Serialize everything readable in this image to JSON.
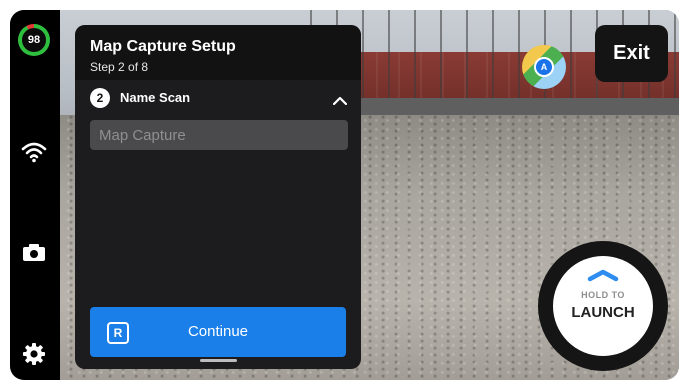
{
  "status": {
    "battery_percent": "98"
  },
  "setup_panel": {
    "title": "Map Capture Setup",
    "subtitle": "Step 2 of 8",
    "step": {
      "number": "2",
      "label": "Name Scan"
    },
    "name_input": {
      "placeholder": "Map Capture",
      "value": ""
    },
    "continue_button": {
      "label": "Continue",
      "badge": "R"
    }
  },
  "header": {
    "exit_label": "Exit"
  },
  "launch": {
    "hold_text": "HOLD TO",
    "main_text": "LAUNCH"
  },
  "map_button": {
    "pin_letter": "A"
  },
  "icons": [
    "wifi-icon",
    "camera-icon",
    "gear-icon",
    "chevron-up-icon",
    "map-icon"
  ],
  "colors": {
    "accent": "#1a7fe8",
    "battery_green": "#2fbf3e",
    "battery_red": "#e53935"
  }
}
